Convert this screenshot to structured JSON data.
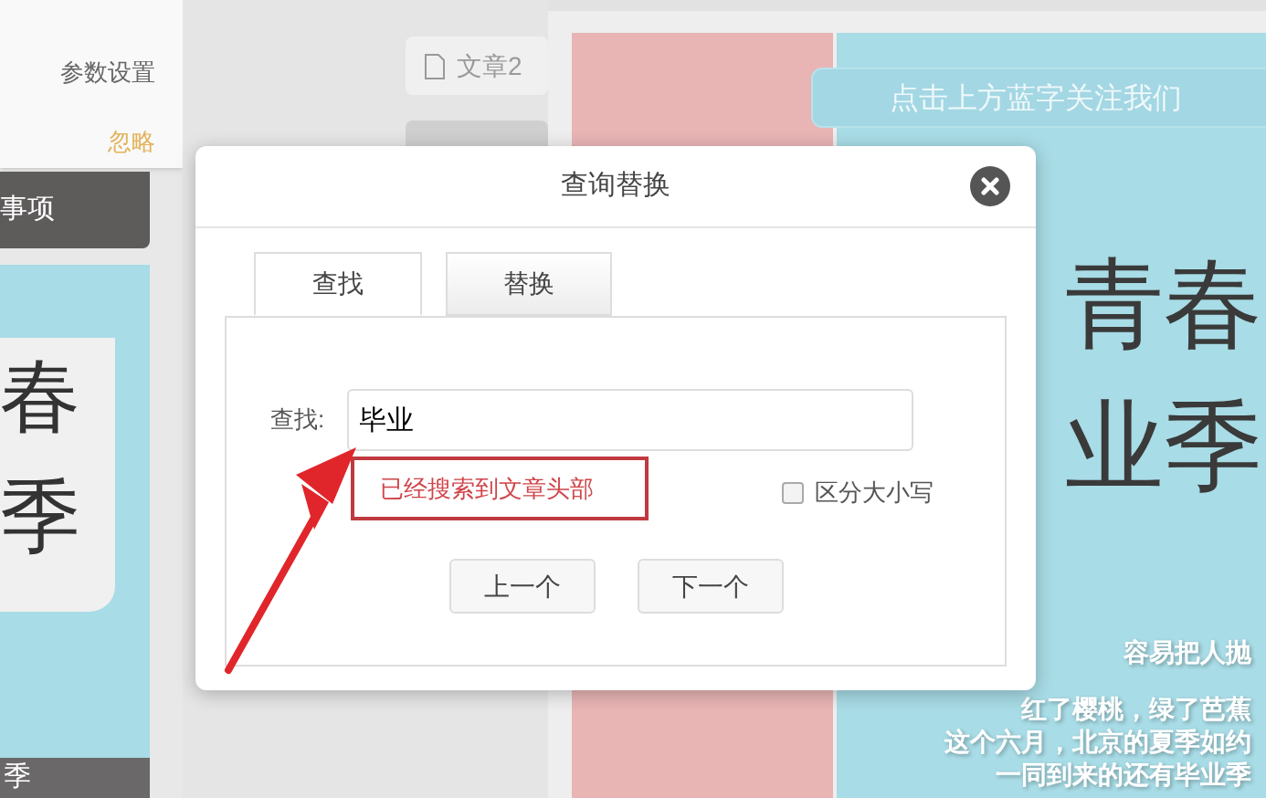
{
  "sidebar": {
    "popup": {
      "title": "参数设置",
      "action": "忽略"
    },
    "section_title": "事项",
    "thumbnail_texts": [
      "春",
      "季"
    ],
    "footer": "季"
  },
  "doc_tab": "文章2",
  "poster": {
    "banner": "点击上方蓝字关注我们",
    "headline": [
      "青春",
      "业季"
    ],
    "lines": [
      "容易把人抛",
      "红了樱桃，绿了芭蕉",
      "这个六月，北京的夏季如约",
      "一同到来的还有毕业季"
    ]
  },
  "dialog": {
    "title": "查询替换",
    "tabs": [
      {
        "label": "查找",
        "selected": true
      },
      {
        "label": "替换",
        "selected": false
      }
    ],
    "find_label": "查找:",
    "find_value": "毕业",
    "message": "已经搜索到文章头部",
    "case_sensitive": {
      "label": "区分大小写",
      "checked": false
    },
    "buttons": [
      "上一个",
      "下一个"
    ]
  }
}
